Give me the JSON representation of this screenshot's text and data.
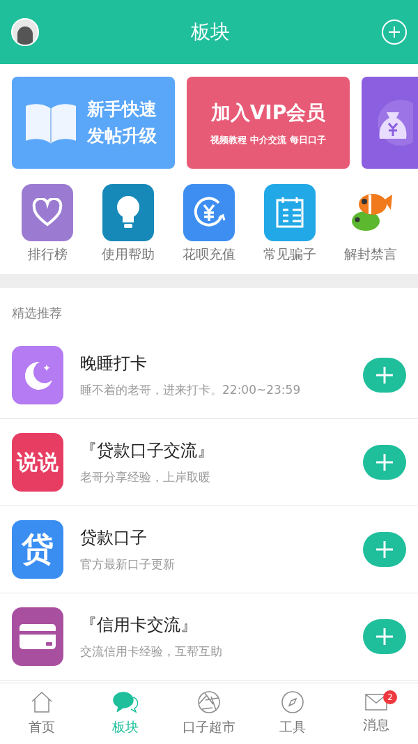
{
  "header": {
    "title": "板块"
  },
  "banners": [
    {
      "kind": "guide",
      "lines": [
        "新手快速",
        "发帖升级"
      ]
    },
    {
      "kind": "vip",
      "title": "加入VIP会员",
      "subtitle": "视频教程 中介交流 每日口子"
    },
    {
      "kind": "money"
    }
  ],
  "shortcuts": [
    {
      "kind": "heart",
      "label": "排行榜"
    },
    {
      "kind": "bulb",
      "label": "使用帮助"
    },
    {
      "kind": "yuan",
      "label": "花呗充值"
    },
    {
      "kind": "note",
      "label": "常见骗子"
    },
    {
      "kind": "fish",
      "label": "解封禁言"
    }
  ],
  "section_title": "精选推荐",
  "boards": [
    {
      "kind": "moon",
      "name": "晚睡打卡",
      "description": "睡不着的老哥，进来打卡。22:00~23:59"
    },
    {
      "kind": "talk",
      "name": "『贷款口子交流』",
      "description": "老哥分享经验，上岸取暖",
      "icon_text": "说说"
    },
    {
      "kind": "loan",
      "name": "贷款口子",
      "description": "官方最新口子更新",
      "icon_text": "贷"
    },
    {
      "kind": "card",
      "name": "『信用卡交流』",
      "description": "交流信用卡经验，互帮互助"
    }
  ],
  "tabs": [
    {
      "kind": "home",
      "label": "首页",
      "selected": false
    },
    {
      "kind": "chat",
      "label": "板块",
      "selected": true
    },
    {
      "kind": "aperture",
      "label": "口子超市",
      "selected": false
    },
    {
      "kind": "compass",
      "label": "工具",
      "selected": false
    },
    {
      "kind": "mail",
      "label": "消息",
      "selected": false,
      "badge": "2"
    }
  ]
}
